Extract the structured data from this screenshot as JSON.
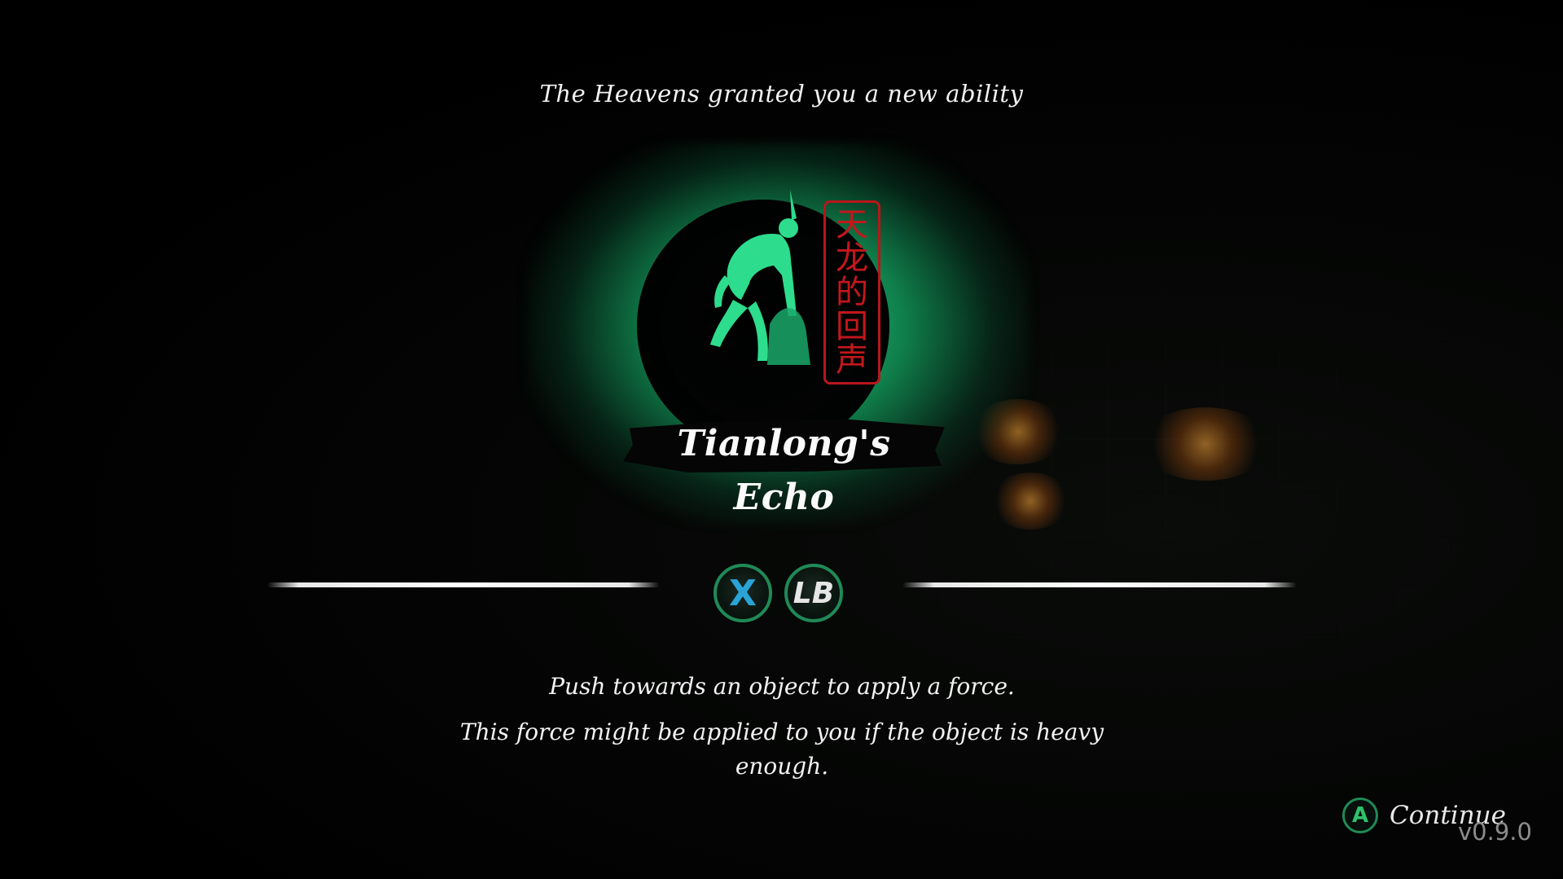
{
  "popup": {
    "heading": "The Heavens granted you a new ability",
    "ability_name": "Tianlong's Echo",
    "seal_characters": [
      "天",
      "龙",
      "的",
      "回",
      "声"
    ],
    "emblem_icon": "crouching-figure-icon"
  },
  "controls": {
    "buttons": [
      {
        "label": "X",
        "icon": "x-button-icon",
        "color": "#2aa4d6"
      },
      {
        "label": "LB",
        "icon": "lb-button-icon",
        "color": "#e6e6e6"
      }
    ]
  },
  "description": {
    "line1": "Push towards an object to apply a force.",
    "line2": "This force might be applied to you if the object is heavy enough."
  },
  "footer": {
    "continue_button_glyph": "A",
    "continue_label": "Continue",
    "version": "v0.9.0"
  },
  "colors": {
    "accent_green": "#2ec26a",
    "glow_green": "#28d282",
    "seal_red": "#c2171c",
    "text": "#f2f2f2"
  }
}
